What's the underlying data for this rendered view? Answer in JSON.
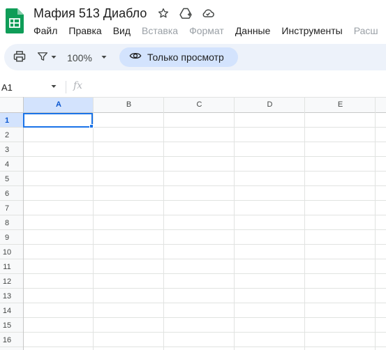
{
  "app": {
    "document_title": "Мафия 513 Диабло",
    "icons": [
      "sheets-logo-icon",
      "star-icon",
      "move-to-drive-icon",
      "cloud-status-icon"
    ],
    "brand_color": "#0f9d58"
  },
  "menu": {
    "items": [
      {
        "label": "Файл",
        "disabled": false
      },
      {
        "label": "Правка",
        "disabled": false
      },
      {
        "label": "Вид",
        "disabled": false
      },
      {
        "label": "Вставка",
        "disabled": true
      },
      {
        "label": "Формат",
        "disabled": true
      },
      {
        "label": "Данные",
        "disabled": false
      },
      {
        "label": "Инструменты",
        "disabled": false
      },
      {
        "label": "Расш",
        "disabled": true
      }
    ]
  },
  "toolbar": {
    "zoom": "100%",
    "view_only_label": "Только просмотр",
    "icons": [
      "print-icon",
      "filter-icon",
      "dropdown-arrow-icon",
      "eye-icon"
    ],
    "background": "#edf2fa",
    "chip_color": "#d3e3fd"
  },
  "formula_bar": {
    "cell_reference": "A1",
    "fx_label": "fx",
    "value": ""
  },
  "grid": {
    "columns": [
      "A",
      "B",
      "C",
      "D",
      "E"
    ],
    "rows": [
      "1",
      "2",
      "3",
      "4",
      "5",
      "6",
      "7",
      "8",
      "9",
      "10",
      "11",
      "12",
      "13",
      "14",
      "15",
      "16"
    ],
    "active_cell": "A1",
    "active_color": "#1a73e8",
    "header_highlight": "#d3e3fd"
  }
}
